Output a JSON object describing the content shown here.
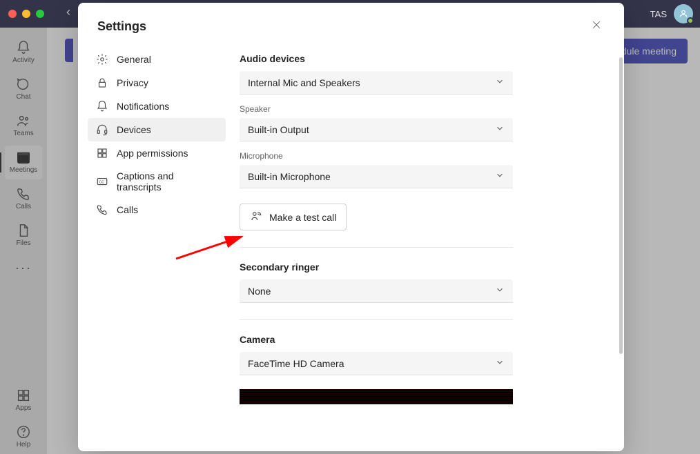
{
  "titlebar": {
    "user_initials": "TAS"
  },
  "rail": {
    "items": [
      {
        "label": "Activity"
      },
      {
        "label": "Chat"
      },
      {
        "label": "Teams"
      },
      {
        "label": "Meetings"
      },
      {
        "label": "Calls"
      },
      {
        "label": "Files"
      }
    ],
    "apps_label": "Apps",
    "help_label": "Help"
  },
  "background": {
    "schedule_button": "dule meeting"
  },
  "modal": {
    "title": "Settings",
    "nav": [
      "General",
      "Privacy",
      "Notifications",
      "Devices",
      "App permissions",
      "Captions and transcripts",
      "Calls"
    ],
    "content": {
      "audio_devices_heading": "Audio devices",
      "audio_device_value": "Internal Mic and Speakers",
      "speaker_label": "Speaker",
      "speaker_value": "Built-in Output",
      "microphone_label": "Microphone",
      "microphone_value": "Built-in Microphone",
      "test_call_label": "Make a test call",
      "secondary_ringer_heading": "Secondary ringer",
      "secondary_ringer_value": "None",
      "camera_heading": "Camera",
      "camera_value": "FaceTime HD Camera"
    }
  }
}
